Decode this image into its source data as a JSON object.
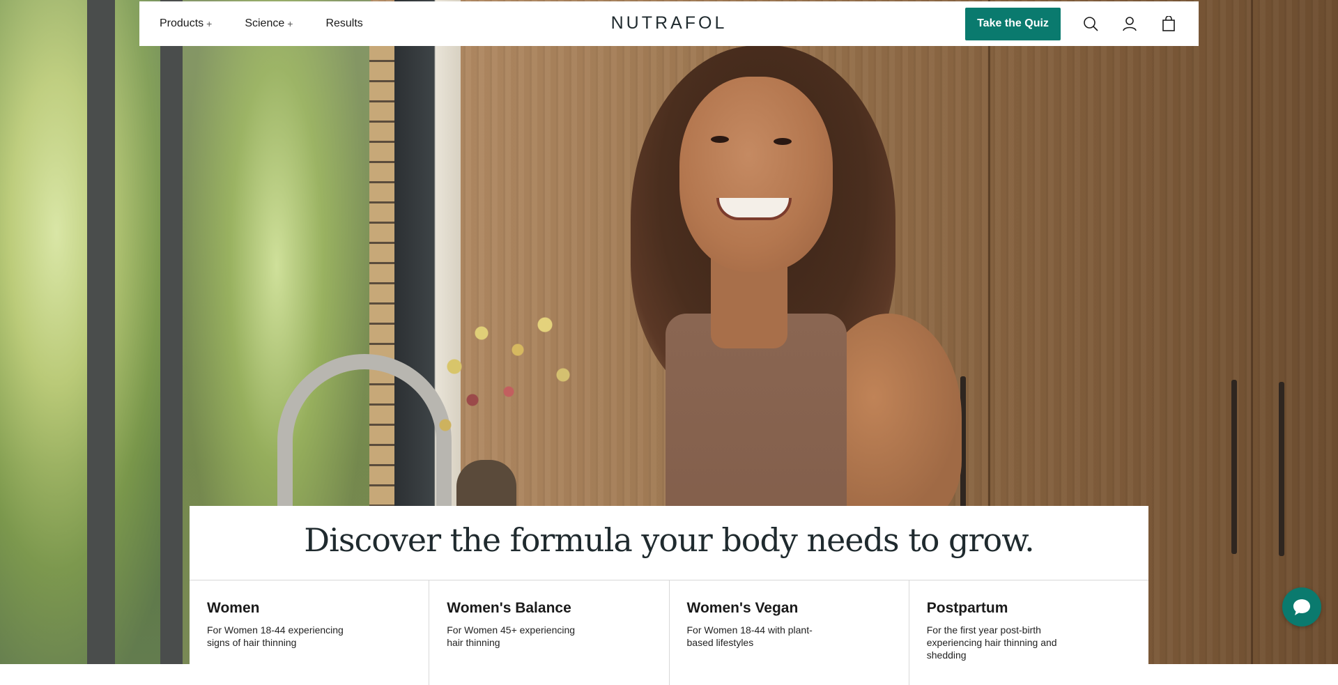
{
  "nav": {
    "links": [
      {
        "label": "Products",
        "suffix": "+"
      },
      {
        "label": "Science",
        "suffix": "+"
      },
      {
        "label": "Results",
        "suffix": ""
      }
    ],
    "logo": "NUTRAFOL",
    "cta_label": "Take the Quiz",
    "icons": [
      "search-icon",
      "account-icon",
      "cart-icon"
    ]
  },
  "hero": {
    "headline": "Discover the formula your body needs to grow."
  },
  "options": [
    {
      "title": "Women",
      "description": "For Women 18-44 experiencing signs of hair thinning"
    },
    {
      "title": "Women's Balance",
      "description": "For Women 45+ experiencing hair thinning"
    },
    {
      "title": "Women's Vegan",
      "description": "For Women 18-44 with plant-based lifestyles"
    },
    {
      "title": "Postpartum",
      "description": "For the first year post-birth experiencing hair thinning and shedding"
    }
  ],
  "chat": {
    "icon": "chat-bubble-icon"
  },
  "colors": {
    "accent": "#0a7a6e",
    "text": "#1f2a2e"
  }
}
